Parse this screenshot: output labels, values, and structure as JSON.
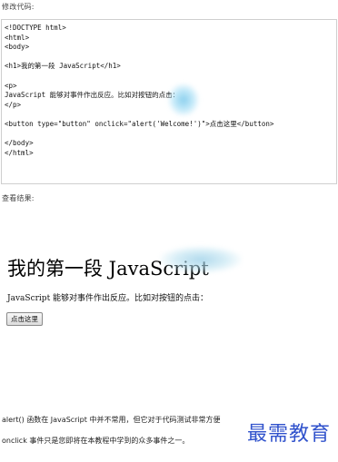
{
  "code_editor": {
    "label": "修改代码:",
    "lines": [
      "<!DOCTYPE html>",
      "<html>",
      "<body>",
      "",
      "<h1>我的第一段 JavaScript</h1>",
      "",
      "<p>",
      "JavaScript 能够对事件作出反应。比如对按钮的点击：",
      "</p>",
      "",
      "<button type=\"button\" onclick=\"alert('Welcome!')\">点击这里</button>",
      "",
      "</body>",
      "</html>"
    ]
  },
  "result": {
    "label": "查看结果:",
    "heading": "我的第一段 JavaScript",
    "paragraph": "JavaScript 能够对事件作出反应。比如对按钮的点击：",
    "button_label": "点击这里"
  },
  "notes": {
    "line1": "alert() 函数在 JavaScript 中并不常用，但它对于代码测试非常方便",
    "line2": "onclick 事件只是您即将在本教程中学到的众多事件之一。"
  },
  "watermark": {
    "text": "最需教育",
    "color": "#1f44c8"
  }
}
